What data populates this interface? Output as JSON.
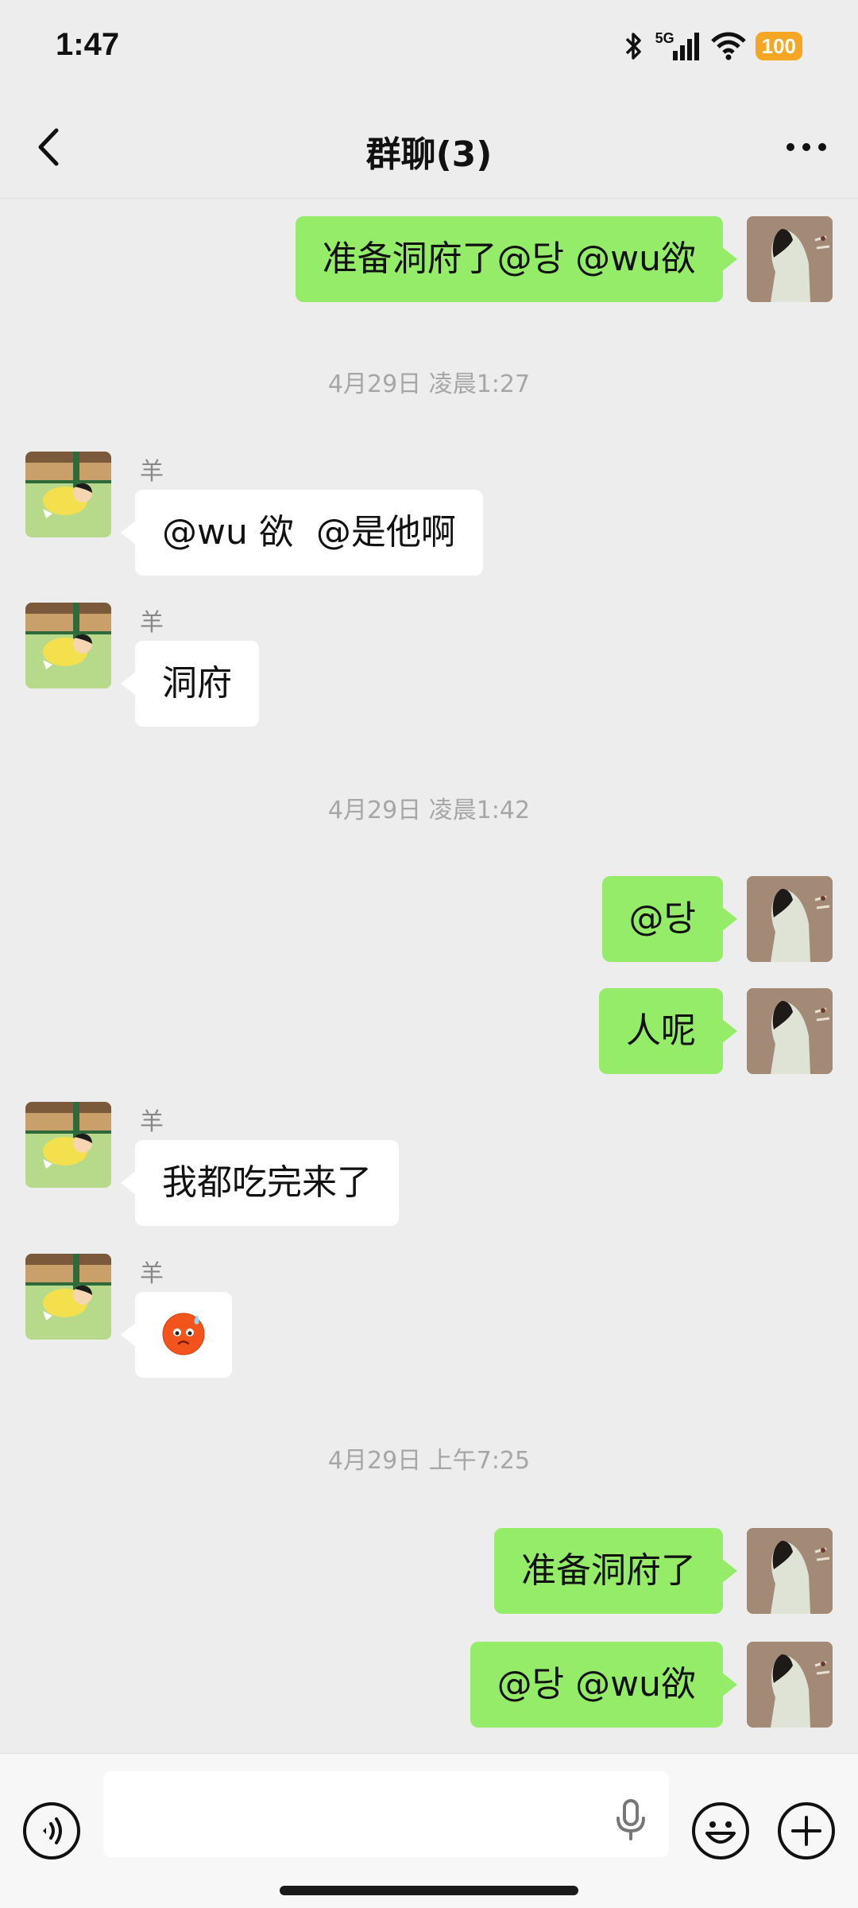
{
  "status_bar": {
    "time": "1:47",
    "network": "5G",
    "battery": "100"
  },
  "header": {
    "title": "群聊(3)"
  },
  "icons": {
    "back": "chevron-left-icon",
    "more": "more-dots-icon",
    "voice": "voice-icon",
    "mic": "microphone-icon",
    "emoji": "emoji-icon",
    "plus": "plus-icon"
  },
  "colors": {
    "my_bubble": "#95ec69",
    "their_bubble": "#ffffff",
    "background": "#ededed"
  },
  "messages": [
    {
      "type": "mine",
      "text": "准备洞府了@당 @wu欲"
    },
    {
      "type": "time",
      "text": "4月29日 凌晨1:27"
    },
    {
      "type": "theirs",
      "sender": "羊",
      "text": "@wu 欲  @是他啊"
    },
    {
      "type": "theirs",
      "sender": "羊",
      "text": "洞府"
    },
    {
      "type": "time",
      "text": "4月29日 凌晨1:42"
    },
    {
      "type": "mine",
      "text": "@당"
    },
    {
      "type": "mine",
      "text": "人呢"
    },
    {
      "type": "theirs",
      "sender": "羊",
      "text": "我都吃完来了"
    },
    {
      "type": "theirs",
      "sender": "羊",
      "text": "",
      "emoji": "sweat-face-emoji"
    },
    {
      "type": "time",
      "text": "4月29日 上午7:25"
    },
    {
      "type": "mine",
      "text": "准备洞府了"
    },
    {
      "type": "mine",
      "text": "@당 @wu欲"
    }
  ],
  "input": {
    "placeholder": ""
  }
}
